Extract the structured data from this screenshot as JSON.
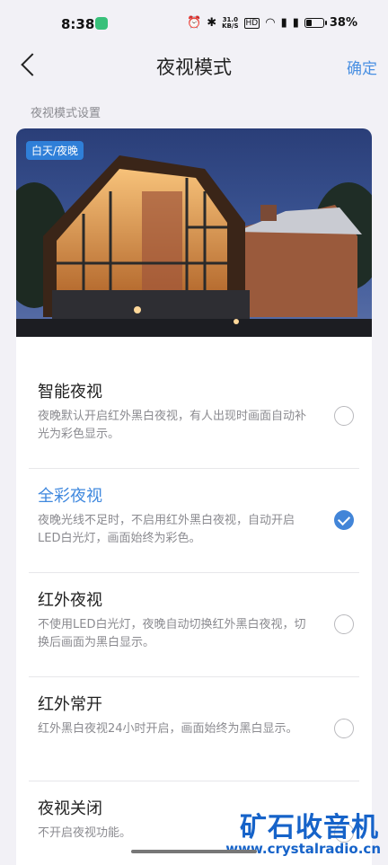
{
  "status_bar": {
    "time": "8:38",
    "net_speed_top": "31.0",
    "net_speed_bottom": "KB/S",
    "hd": "HD",
    "battery_text": "38%",
    "battery_level": 0.38
  },
  "nav": {
    "title": "夜视模式",
    "confirm": "确定"
  },
  "section_label": "夜视模式设置",
  "preview": {
    "tag": "白天/夜晚"
  },
  "options": [
    {
      "title": "智能夜视",
      "desc": "夜晚默认开启红外黑白夜视，有人出现时画面自动补光为彩色显示。",
      "selected": false
    },
    {
      "title": "全彩夜视",
      "desc": "夜晚光线不足时，不启用红外黑白夜视，自动开启LED白光灯，画面始终为彩色。",
      "selected": true
    },
    {
      "title": "红外夜视",
      "desc": "不使用LED白光灯，夜晚自动切换红外黑白夜视，切换后画面为黑白显示。",
      "selected": false
    },
    {
      "title": "红外常开",
      "desc": "红外黑白夜视24小时开启，画面始终为黑白显示。",
      "selected": false
    },
    {
      "title": "夜视关闭",
      "desc": "不开启夜视功能。",
      "selected": false
    }
  ],
  "watermark": {
    "name": "矿石收音机",
    "url": "www.crystalradio.cn"
  },
  "colors": {
    "accent": "#4285d8",
    "background": "#f2f1f6"
  }
}
